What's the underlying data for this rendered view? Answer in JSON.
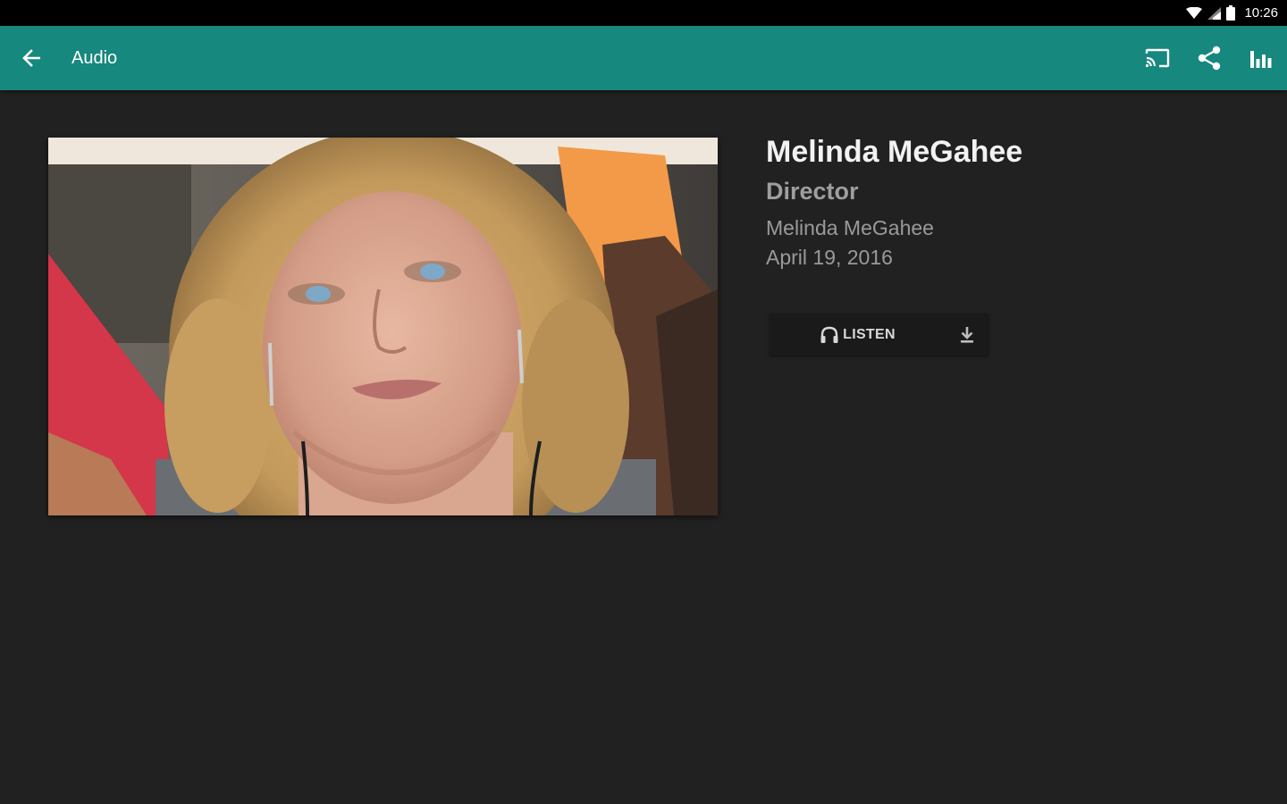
{
  "status_bar": {
    "time": "10:26",
    "icons": [
      "wifi-icon",
      "cell-signal-icon",
      "battery-icon"
    ]
  },
  "app_bar": {
    "title": "Audio",
    "back_icon": "arrow-back-icon",
    "actions": [
      "cast-icon",
      "share-icon",
      "equalizer-icon"
    ],
    "color": "#16887d"
  },
  "detail": {
    "title": "Melinda MeGahee",
    "role": "Director",
    "speaker": "Melinda MeGahee",
    "date": "April 19, 2016",
    "photo_icon": "speaker-photo"
  },
  "media": {
    "listen_label": "LISTEN",
    "listen_icon": "headphones-icon",
    "download_icon": "download-icon"
  },
  "colors": {
    "background": "#212121",
    "status_bar": "#000000"
  }
}
